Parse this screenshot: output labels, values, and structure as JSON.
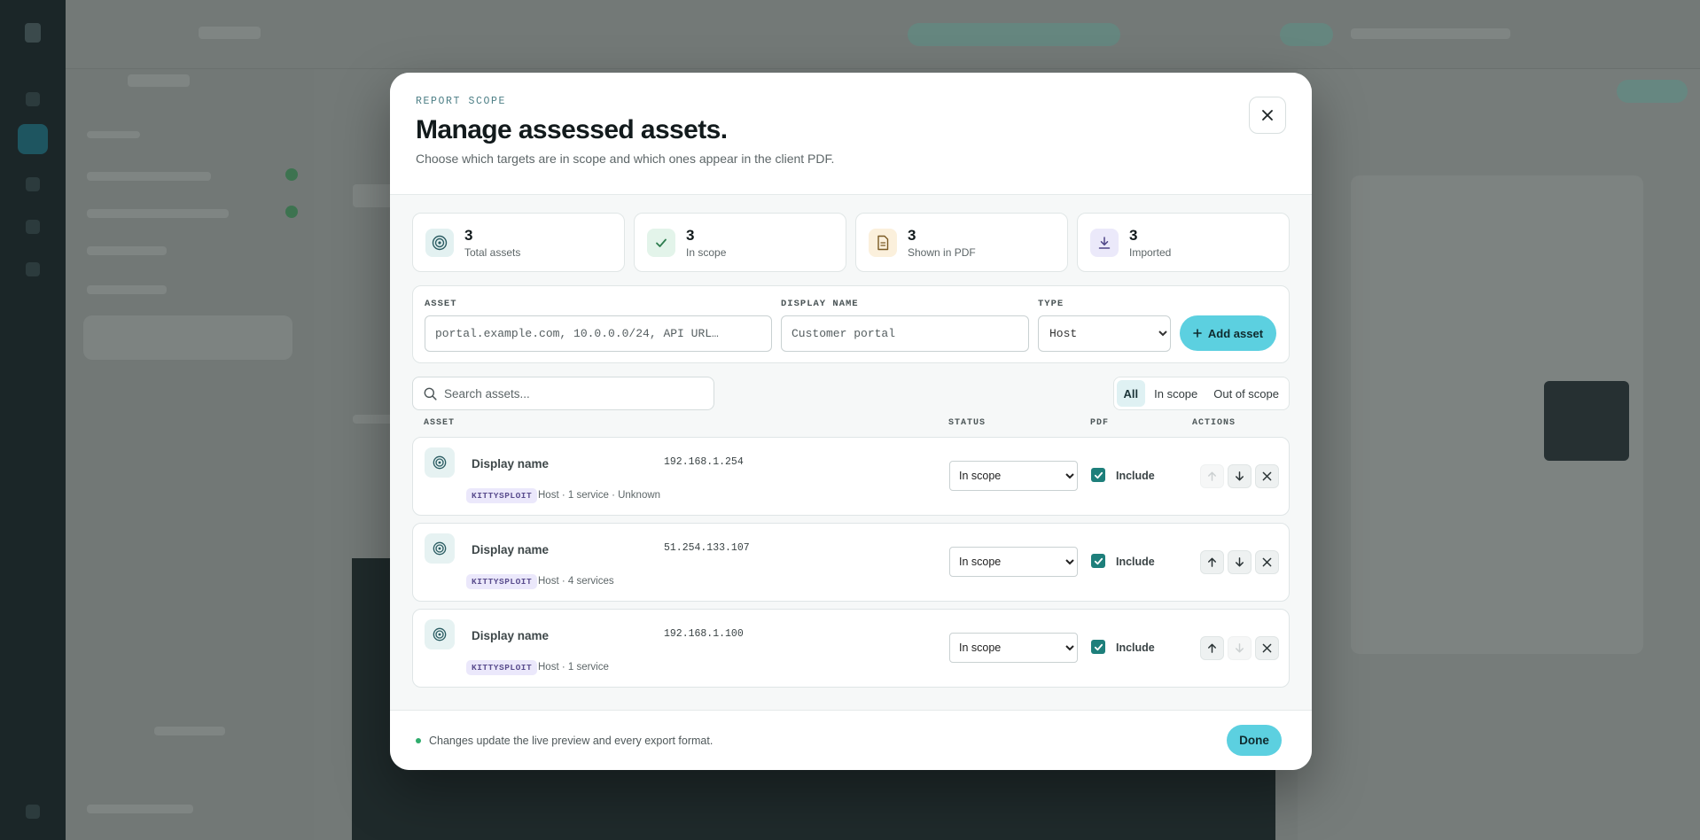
{
  "modal": {
    "eyebrow": "REPORT SCOPE",
    "title": "Manage assessed assets.",
    "subtitle": "Choose which targets are in scope and which ones appear in the client PDF."
  },
  "stats": [
    {
      "value": "3",
      "label": "Total assets",
      "icon": "target-icon",
      "color": "#e3f1f1"
    },
    {
      "value": "3",
      "label": "In scope",
      "icon": "check-icon",
      "color": "#e3f4ea"
    },
    {
      "value": "3",
      "label": "Shown in PDF",
      "icon": "document-icon",
      "color": "#fbf0dc"
    },
    {
      "value": "3",
      "label": "Imported",
      "icon": "download-icon",
      "color": "#ebe9fa"
    }
  ],
  "add_form": {
    "asset_label": "ASSET",
    "asset_placeholder": "portal.example.com, 10.0.0.0/24, API URL…",
    "display_name_label": "DISPLAY NAME",
    "display_name_placeholder": "Customer portal",
    "type_label": "TYPE",
    "type_value": "Host",
    "add_button": "Add asset"
  },
  "search": {
    "placeholder": "Search assets..."
  },
  "filters": [
    "All",
    "In scope",
    "Out of scope"
  ],
  "table_headers": {
    "asset": "ASSET",
    "status": "STATUS",
    "pdf": "PDF",
    "actions": "ACTIONS"
  },
  "assets": [
    {
      "name": "Display name",
      "ip": "192.168.1.254",
      "tag": "KITTYSPLOIT",
      "meta": "Host · 1 service · Unknown",
      "status": "In scope",
      "include_label": "Include",
      "included": true,
      "up_enabled": false,
      "down_enabled": true
    },
    {
      "name": "Display name",
      "ip": "51.254.133.107",
      "tag": "KITTYSPLOIT",
      "meta": "Host · 4 services",
      "status": "In scope",
      "include_label": "Include",
      "included": true,
      "up_enabled": true,
      "down_enabled": true
    },
    {
      "name": "Display name",
      "ip": "192.168.1.100",
      "tag": "KITTYSPLOIT",
      "meta": "Host · 1 service",
      "status": "In scope",
      "include_label": "Include",
      "included": true,
      "up_enabled": true,
      "down_enabled": false
    }
  ],
  "footer": {
    "note": "Changes update the live preview and every export format.",
    "done_button": "Done"
  },
  "colors": {
    "accent": "#5cd0e0",
    "checkbox": "#1e7f7b",
    "status_dot": "#2eac6c"
  }
}
